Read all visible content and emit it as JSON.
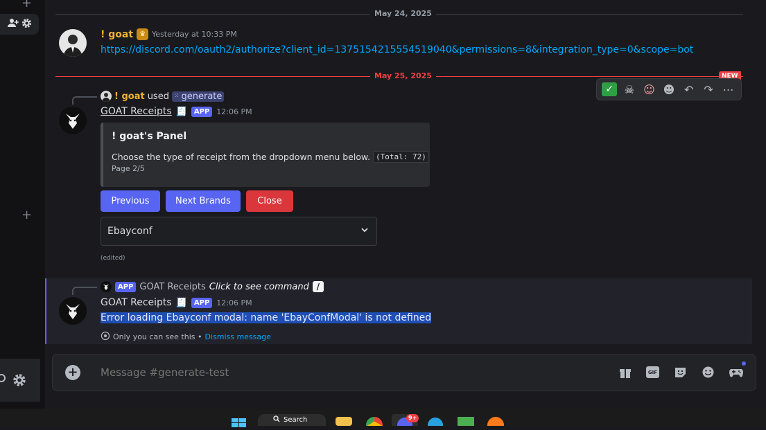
{
  "date_dividers": {
    "first": "May 24, 2025",
    "second": "May 25, 2025",
    "new_badge": "NEW"
  },
  "message1": {
    "username": "! goat",
    "timestamp": "Yesterday at 10:33 PM",
    "link": "https://discord.com/oauth2/authorize?client_id=1375154215554519040&permissions=8&integration_type=0&scope=bot"
  },
  "message2": {
    "reply_user": "! goat",
    "reply_used": "used",
    "reply_command": "generate",
    "bot_name": "GOAT Receipts",
    "app_badge": "APP",
    "timestamp": "12:06 PM",
    "embed": {
      "title": "! goat's Panel",
      "description": "Choose the type of receipt from the dropdown menu below.",
      "total": "(Total: 72)",
      "footer": "Page 2/5"
    },
    "buttons": {
      "previous": "Previous",
      "next": "Next Brands",
      "close": "Close"
    },
    "select_value": "Ebayconf",
    "edited": "(edited)"
  },
  "message3": {
    "reply_app_badge": "APP",
    "reply_bot": "GOAT Receipts",
    "reply_hint": "Click to see command",
    "bot_name": "GOAT Receipts",
    "app_badge": "APP",
    "timestamp": "12:06 PM",
    "error_text": "Error loading Ebayconf modal: name 'EbayConfModal' is not defined",
    "only_you": "Only you can see this •",
    "dismiss": "Dismiss message"
  },
  "composer": {
    "placeholder": "Message #generate-test"
  },
  "taskbar": {
    "search": "Search",
    "discord_badge": "9+"
  },
  "colors": {
    "username_gold": "#f0b232",
    "blurple": "#5865f2",
    "danger": "#da373c",
    "link": "#00a8fc",
    "new_red": "#f23f43"
  }
}
